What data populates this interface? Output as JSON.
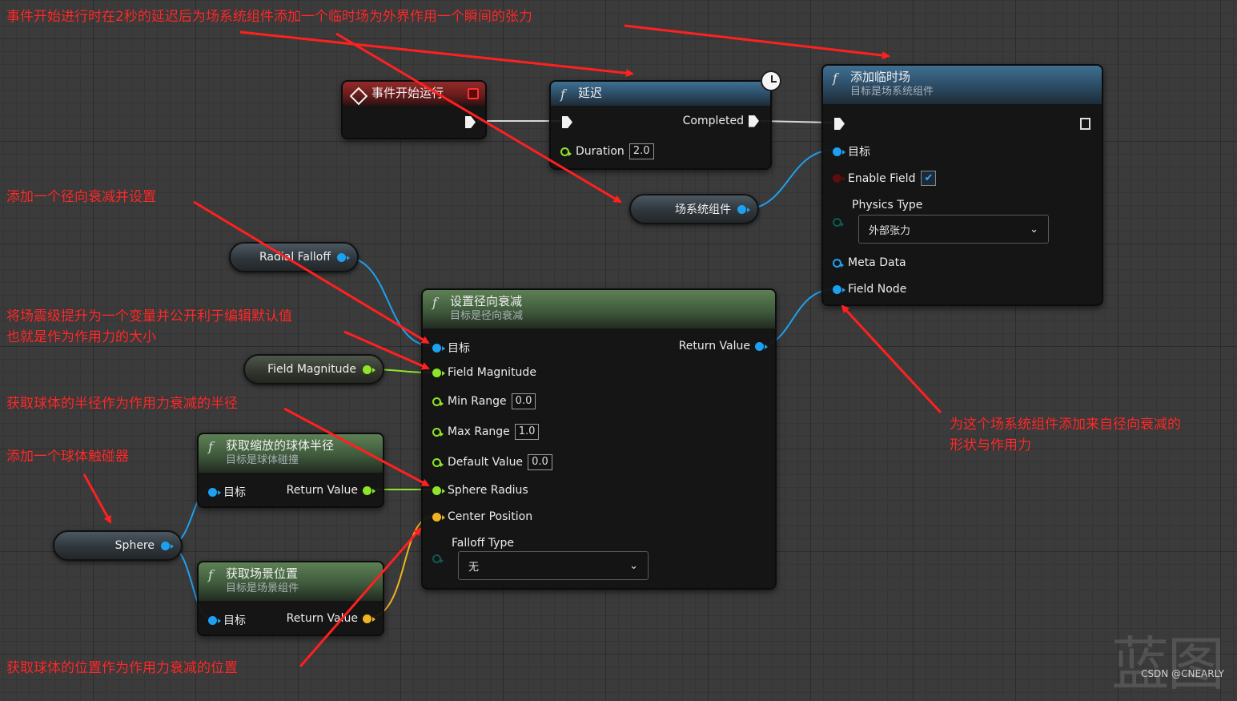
{
  "nodes": {
    "begin_play": {
      "title": "事件开始运行"
    },
    "delay": {
      "title": "延迟",
      "completed_label": "Completed",
      "duration_label": "Duration",
      "duration_value": "2.0"
    },
    "add_transient": {
      "title": "添加临时场",
      "subtitle": "目标是场系统组件",
      "target_label": "目标",
      "enable_label": "Enable Field",
      "physics_label": "Physics Type",
      "physics_value": "外部张力",
      "meta_label": "Meta Data",
      "node_label": "Field Node"
    },
    "set_falloff": {
      "title": "设置径向衰减",
      "subtitle": "目标是径向衰减",
      "target_label": "目标",
      "return_label": "Return Value",
      "magnitude_label": "Field Magnitude",
      "min_label": "Min Range",
      "min_value": "0.0",
      "max_label": "Max Range",
      "max_value": "1.0",
      "default_label": "Default Value",
      "default_value": "0.0",
      "radius_label": "Sphere Radius",
      "center_label": "Center Position",
      "falloff_label": "Falloff Type",
      "falloff_value": "无"
    },
    "get_radius": {
      "title": "获取缩放的球体半径",
      "subtitle": "目标是球体碰撞",
      "target_label": "目标",
      "return_label": "Return Value"
    },
    "get_location": {
      "title": "获取场景位置",
      "subtitle": "目标是场景组件",
      "target_label": "目标",
      "return_label": "Return Value"
    }
  },
  "variables": {
    "field_component": "场系统组件",
    "radial_falloff": "Radial Falloff",
    "field_magnitude": "Field Magnitude",
    "sphere": "Sphere"
  },
  "annotations": {
    "a1": "事件开始进行时在2秒的延迟后为场系统组件添加一个临时场为外界作用一个瞬间的张力",
    "a2": "添加一个径向衰减并设置",
    "a3_line1": "将场震级提升为一个变量并公开利于编辑默认值",
    "a3_line2": "也就是作为作用力的大小",
    "a4": "获取球体的半径作为作用力衰减的半径",
    "a5": "添加一个球体触碰器",
    "a6_line1": "为这个场系统组件添加来自径向衰减的",
    "a6_line2": "形状与作用力",
    "a7": "获取球体的位置作为作用力衰减的位置"
  },
  "watermark": "CSDN @CNEARLY",
  "colors": {
    "annotation": "#ff2a2a",
    "object_pin": "#1ea0f0",
    "float_pin": "#8ee62a",
    "vector_pin": "#f0b420"
  }
}
